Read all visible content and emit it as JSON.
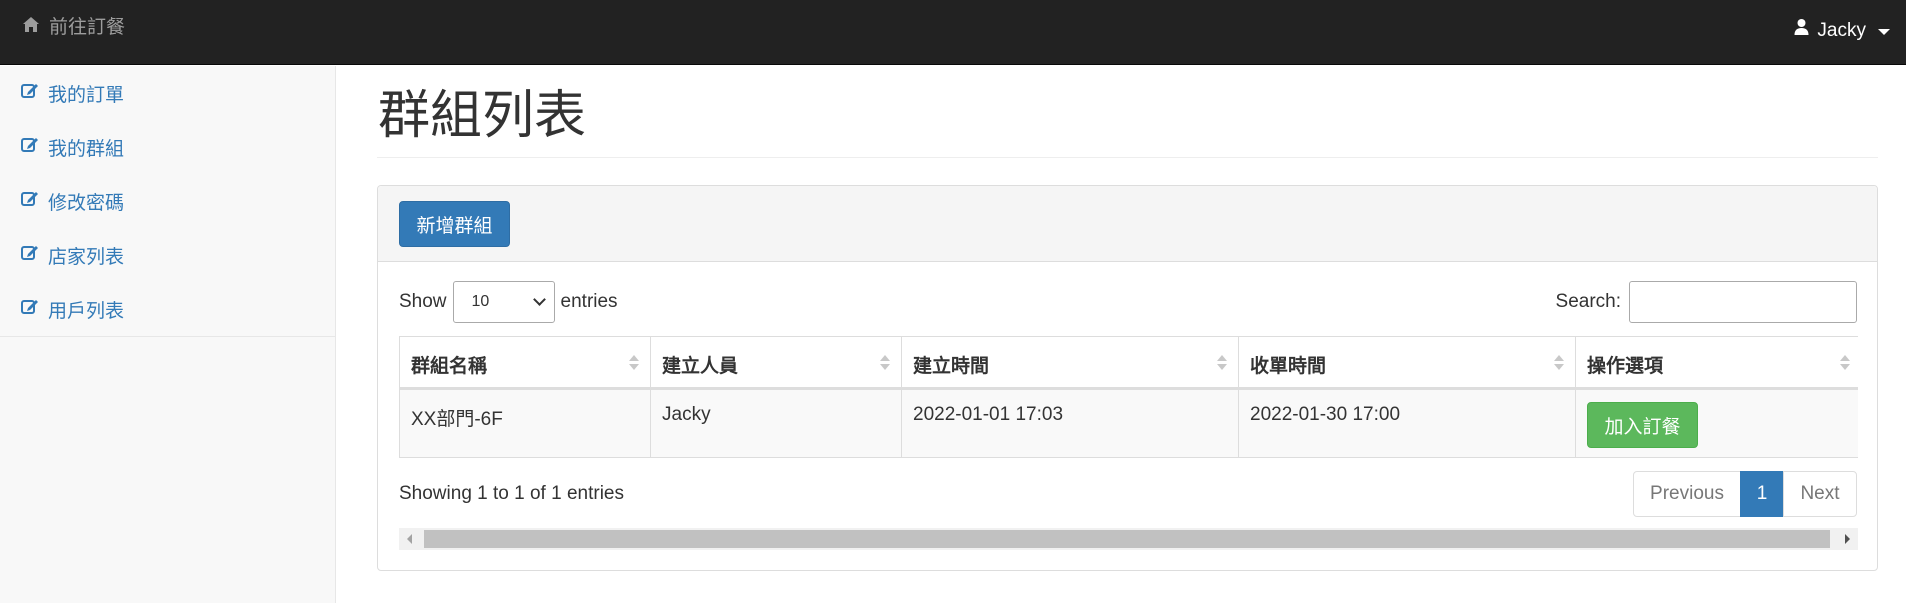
{
  "navbar": {
    "brand_label": "前往訂餐",
    "brand_icon": "home-icon",
    "user_name": "Jacky",
    "user_icon": "user-icon"
  },
  "sidebar": {
    "items": [
      {
        "label": "我的訂單",
        "icon": "edit-icon"
      },
      {
        "label": "我的群組",
        "icon": "edit-icon"
      },
      {
        "label": "修改密碼",
        "icon": "edit-icon"
      },
      {
        "label": "店家列表",
        "icon": "edit-icon"
      },
      {
        "label": "用戶列表",
        "icon": "edit-icon"
      }
    ]
  },
  "main": {
    "title": "群組列表",
    "add_button": "新增群組",
    "length": {
      "prefix": "Show",
      "value": "10",
      "suffix": "entries"
    },
    "search": {
      "label": "Search:",
      "value": ""
    },
    "table": {
      "headers": [
        "群組名稱",
        "建立人員",
        "建立時間",
        "收單時間",
        "操作選項"
      ],
      "rows": [
        {
          "name": "XX部門-6F",
          "creator": "Jacky",
          "created": "2022-01-01 17:03",
          "closing": "2022-01-30 17:00",
          "action": "加入訂餐"
        }
      ]
    },
    "info": "Showing 1 to 1 of 1 entries",
    "pagination": {
      "previous": "Previous",
      "current": "1",
      "next": "Next"
    }
  },
  "colors": {
    "navbar_bg": "#222222",
    "primary": "#337ab7",
    "success": "#5cb85c",
    "sidebar_bg": "#f8f8f8"
  }
}
